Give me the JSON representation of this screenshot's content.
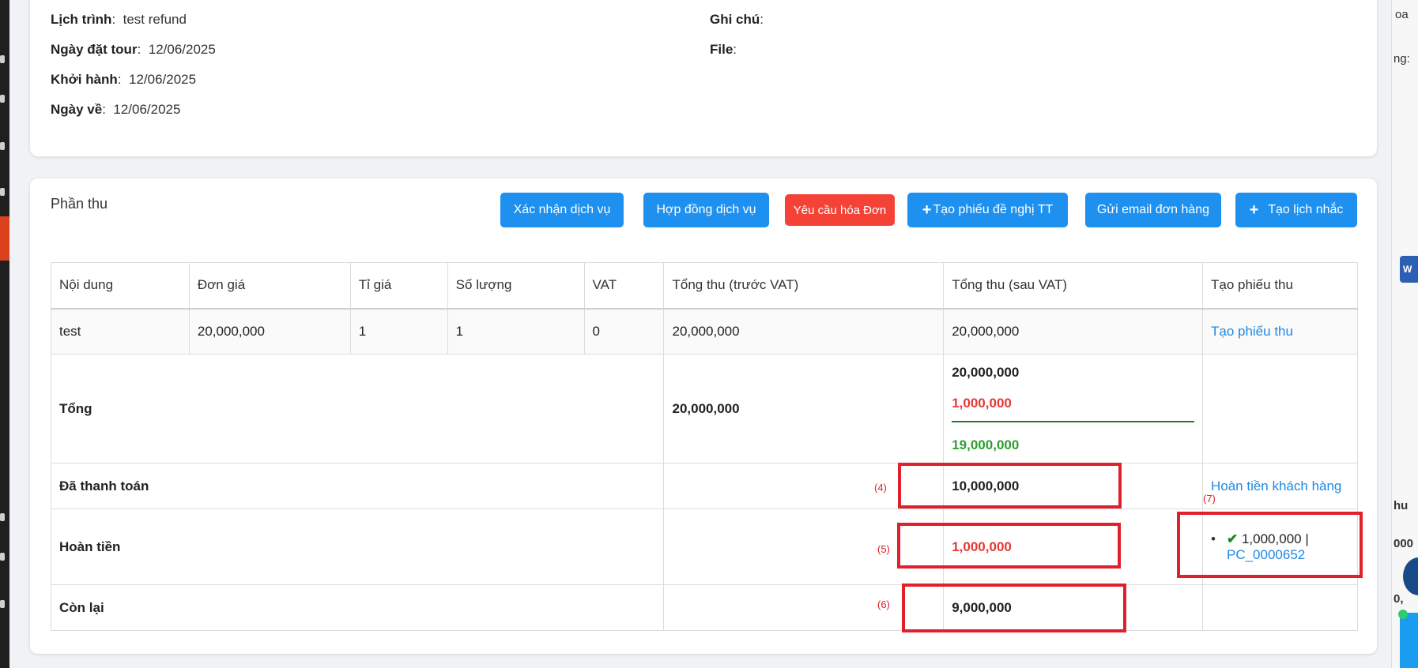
{
  "info": {
    "itinerary_label": "Lịch trình",
    "itinerary_value": "test refund",
    "booking_date_label": "Ngày đặt tour",
    "booking_date_value": "12/06/2025",
    "departure_label": "Khởi hành",
    "departure_value": "12/06/2025",
    "return_label": "Ngày về",
    "return_value": "12/06/2025",
    "note_label": "Ghi chú",
    "file_label": "File"
  },
  "section": {
    "title": "Phần thu"
  },
  "buttons": {
    "confirm_service": "Xác nhận dịch vụ",
    "service_contract": "Hợp đồng dịch vụ",
    "request_invoice": "Yêu cầu hóa Đơn",
    "create_payment_request": "Tạo phiếu đề nghị TT",
    "send_order_email": "Gửi email đơn hàng",
    "create_reminder": "Tạo lịch nhắc"
  },
  "table": {
    "headers": [
      "Nội dung",
      "Đơn giá",
      "Tỉ giá",
      "Số lượng",
      "VAT",
      "Tổng thu (trước VAT)",
      "Tổng thu (sau VAT)",
      "Tạo phiếu thu"
    ],
    "item": {
      "content": "test",
      "unit_price": "20,000,000",
      "rate": "1",
      "quantity": "1",
      "vat": "0",
      "total_before_vat": "20,000,000",
      "total_after_vat": "20,000,000",
      "create_receipt": "Tạo phiếu thu"
    },
    "total": {
      "label": "Tổng",
      "before_vat": "20,000,000",
      "after_vat": "20,000,000",
      "discount": "1,000,000",
      "net": "19,000,000"
    },
    "paid": {
      "label": "Đã thanh toán",
      "value": "10,000,000",
      "action": "Hoàn tiền khách hàng"
    },
    "refund": {
      "label": "Hoàn tiền",
      "value": "1,000,000",
      "entry_amount": "1,000,000 |",
      "entry_code": "PC_0000652"
    },
    "remaining": {
      "label": "Còn lại",
      "value": "9,000,000"
    }
  },
  "annotations": {
    "a4": "(4)",
    "a5": "(5)",
    "a6": "(6)",
    "a7": "(7)"
  },
  "right_panel": {
    "t1": "oa",
    "t2": "ng:",
    "t3": "hu",
    "t4": "000",
    "t5": "0,",
    "word_icon": "W"
  },
  "colors": {
    "primary": "#1e90f0",
    "danger": "#f44336",
    "success": "#2ea02e",
    "annotation": "#e0202a"
  }
}
